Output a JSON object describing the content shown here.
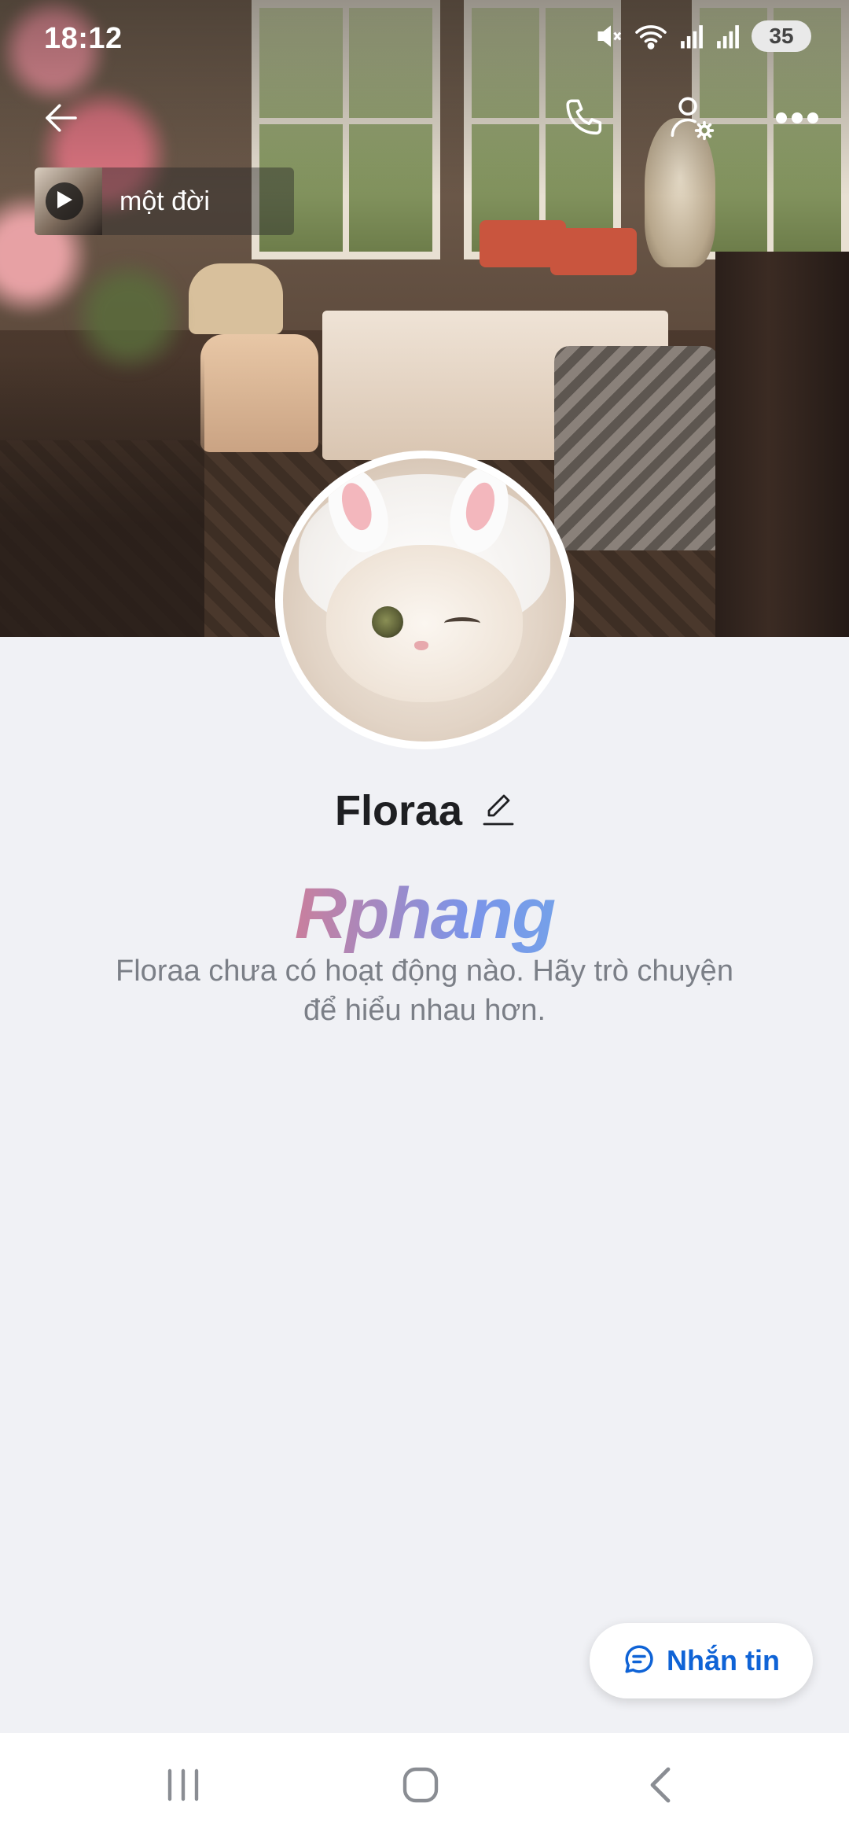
{
  "status_bar": {
    "time": "18:12",
    "battery": "35"
  },
  "music": {
    "title": "một đời"
  },
  "profile": {
    "name": "Floraa",
    "empty_message": "Floraa chưa có hoạt động nào. Hãy trò chuyện để hiểu nhau hơn."
  },
  "watermark": {
    "text": "Rphang"
  },
  "actions": {
    "message_label": "Nhắn tin"
  },
  "icons": {
    "back": "back-arrow-icon",
    "call": "phone-icon",
    "settings": "user-settings-icon",
    "more": "more-options-icon",
    "play": "play-icon",
    "edit": "pencil-icon",
    "chat": "chat-bubble-icon"
  },
  "colors": {
    "accent": "#0f63d6",
    "background": "#f0f1f5",
    "text_primary": "#1e1f22",
    "text_secondary": "#7b7f87"
  }
}
